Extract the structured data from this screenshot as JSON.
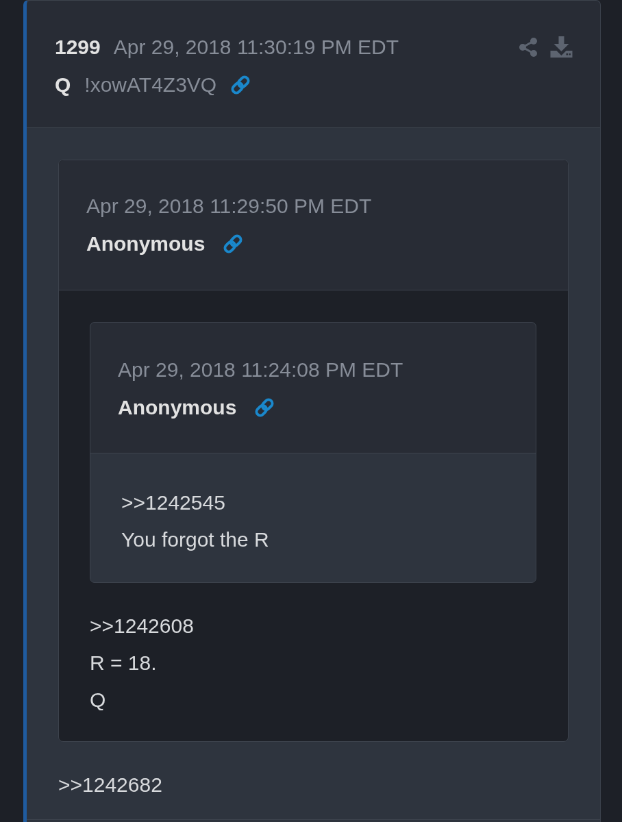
{
  "post": {
    "number": "1299",
    "timestamp": "Apr 29, 2018 11:30:19 PM EDT",
    "author": "Q",
    "tripcode": "!xowAT4Z3VQ",
    "quoted_post": {
      "timestamp": "Apr 29, 2018 11:29:50 PM EDT",
      "author": "Anonymous",
      "quoted_post": {
        "timestamp": "Apr 29, 2018 11:24:08 PM EDT",
        "author": "Anonymous",
        "body_lines": [
          ">>1242545",
          "You forgot the R"
        ]
      },
      "body_lines": [
        ">>1242608",
        "R = 18.",
        "Q"
      ]
    },
    "body_lines": [
      ">>1242682"
    ]
  }
}
